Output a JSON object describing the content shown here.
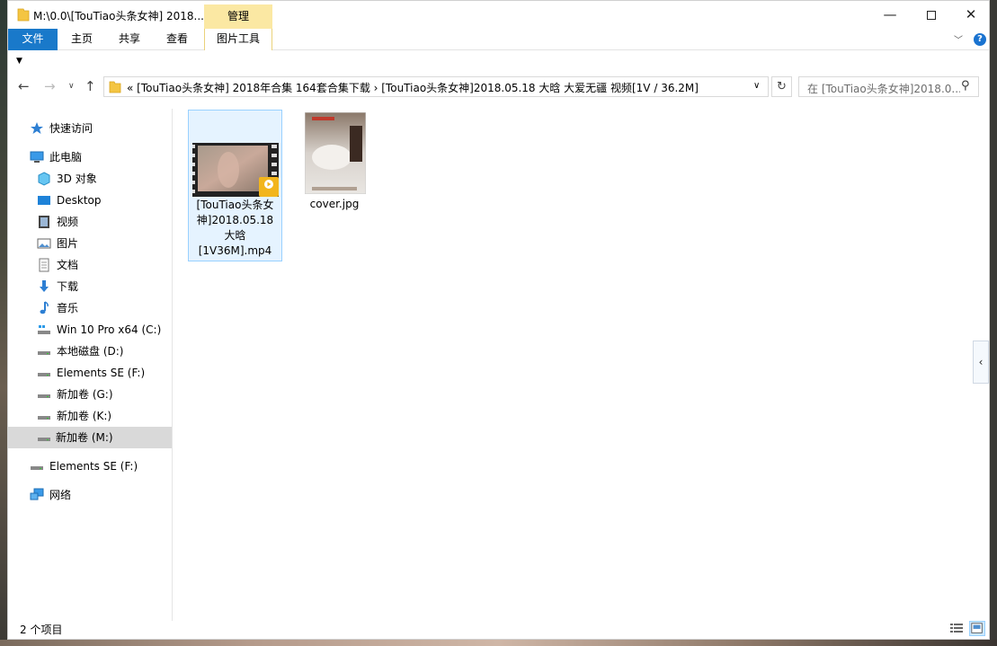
{
  "window": {
    "title": "M:\\0.0\\[TouTiao头条女神] 2018...",
    "manage_tab": "管理"
  },
  "ribbon": {
    "tabs": [
      "文件",
      "主页",
      "共享",
      "查看",
      "图片工具"
    ]
  },
  "address": {
    "path": "«   [TouTiao头条女神] 2018年合集 164套合集下载   ›   [TouTiao头条女神]2018.05.18 大晗 大爱无疆 视频[1V / 36.2M]"
  },
  "search": {
    "placeholder": "在 [TouTiao头条女神]2018.0..."
  },
  "nav": {
    "quick_access": "快速访问",
    "this_pc": "此电脑",
    "objects_3d": "3D 对象",
    "desktop": "Desktop",
    "videos": "视频",
    "pictures": "图片",
    "documents": "文档",
    "downloads": "下载",
    "music": "音乐",
    "drive_c": "Win 10 Pro x64 (C:)",
    "drive_d": "本地磁盘 (D:)",
    "drive_f": "Elements SE (F:)",
    "drive_g": "新加卷 (G:)",
    "drive_k": "新加卷 (K:)",
    "drive_m": "新加卷 (M:)",
    "elements_root": "Elements SE (F:)",
    "network": "网络"
  },
  "files": [
    {
      "name": "[TouTiao头条女神]2018.05.18大晗[1V36M].mp4",
      "name_lines": [
        "[TouTiao头条女",
        "神]2018.05.18",
        "大晗",
        "[1V36M].mp4"
      ]
    },
    {
      "name": "cover.jpg"
    }
  ],
  "status": {
    "count": "2 个项目"
  },
  "colors": {
    "accent": "#1979ca",
    "manage_tab": "#fbe8a3",
    "selection_bg": "#e5f3ff",
    "selection_border": "#99d1ff"
  }
}
